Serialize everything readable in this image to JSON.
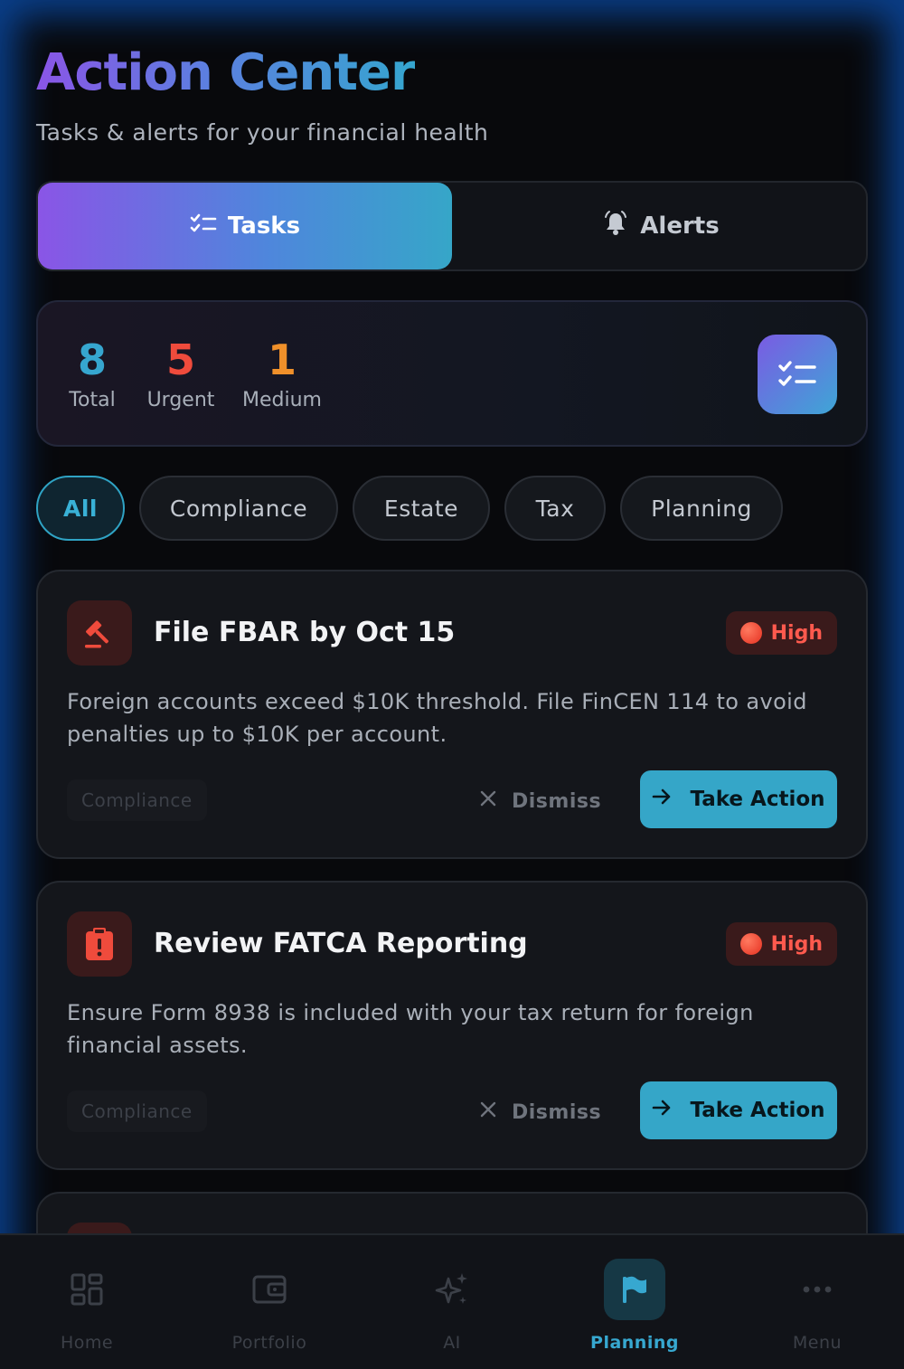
{
  "header": {
    "title": "Action Center",
    "subtitle": "Tasks & alerts for your financial health"
  },
  "tabs": [
    {
      "label": "Tasks",
      "icon": "checklist-icon",
      "active": true
    },
    {
      "label": "Alerts",
      "icon": "bell-icon",
      "active": false
    }
  ],
  "stats": {
    "total": {
      "value": "8",
      "label": "Total",
      "color": "#36a6cf"
    },
    "urgent": {
      "value": "5",
      "label": "Urgent",
      "color": "#ef4b3c"
    },
    "medium": {
      "value": "1",
      "label": "Medium",
      "color": "#f0902a"
    },
    "icon": "checklist-icon"
  },
  "filters": [
    "All",
    "Compliance",
    "Estate",
    "Tax",
    "Planning"
  ],
  "active_filter": "All",
  "tasks": [
    {
      "title": "File FBAR by Oct 15",
      "icon": "gavel-icon",
      "priority": "High",
      "description": "Foreign accounts exceed $10K threshold. File FinCEN 114 to avoid penalties up to $10K per account.",
      "category": "Compliance",
      "dismiss_label": "Dismiss",
      "action_label": "Take Action"
    },
    {
      "title": "Review FATCA Reporting",
      "icon": "clipboard-alert-icon",
      "priority": "High",
      "description": "Ensure Form 8938 is included with your tax return for foreign financial assets.",
      "category": "Compliance",
      "dismiss_label": "Dismiss",
      "action_label": "Take Action"
    }
  ],
  "nav": [
    {
      "label": "Home",
      "icon": "grid-icon",
      "active": false
    },
    {
      "label": "Portfolio",
      "icon": "wallet-icon",
      "active": false
    },
    {
      "label": "AI",
      "icon": "sparkles-icon",
      "active": false
    },
    {
      "label": "Planning",
      "icon": "flag-icon",
      "active": true
    },
    {
      "label": "Menu",
      "icon": "more-icon",
      "active": false
    }
  ],
  "colors": {
    "accent": "#35a6c8",
    "purple": "#8a55e6",
    "high": "#ff5a4e"
  }
}
